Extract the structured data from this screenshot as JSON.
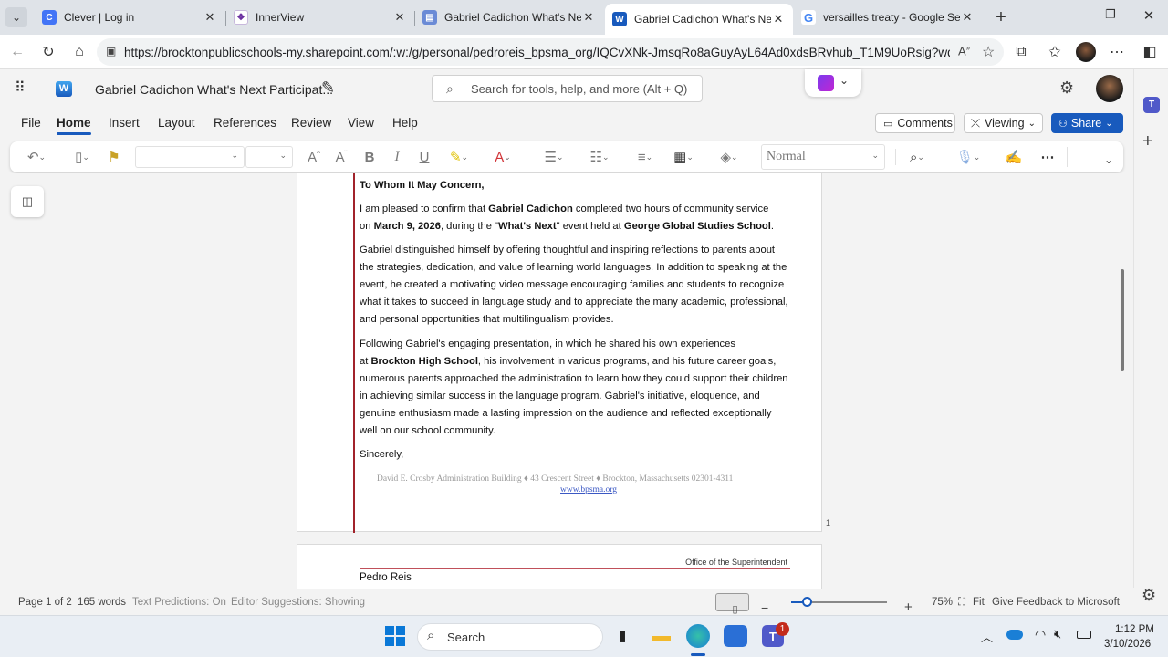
{
  "browser": {
    "tabs": [
      {
        "title": "Clever | Log in",
        "icon": "clever-icon",
        "color": "#4274f6"
      },
      {
        "title": "InnerView",
        "icon": "innerview-icon",
        "color": "#6b2fa0"
      },
      {
        "title": "Gabriel Cadichon What's Next F",
        "icon": "word-doc-icon",
        "color": "#6b8bd6"
      },
      {
        "title": "Gabriel Cadichon What's Next F",
        "icon": "word-icon",
        "color": "#185abd"
      },
      {
        "title": "versailles treaty - Google Searc",
        "icon": "google-icon",
        "color": "#4285f4"
      }
    ],
    "url": "https://brocktonpublicschools-my.sharepoint.com/:w:/g/personal/pedroreis_bpsma_org/IQCvXNk-JmsqRo8aGuyAyL64Ad0xdsBRvhub_T1M9UoRsig?wdOri..."
  },
  "word": {
    "doc_title": "Gabriel Cadichon What's Next Participat...",
    "search_placeholder": "Search for tools, help, and more (Alt + Q)",
    "menus": [
      "File",
      "Home",
      "Insert",
      "Layout",
      "References",
      "Review",
      "View",
      "Help"
    ],
    "comments_label": "Comments",
    "viewing_label": "Viewing",
    "share_label": "Share",
    "style_value": "Normal",
    "accent": "#185abd"
  },
  "document": {
    "salutation": "To Whom It May Concern,",
    "p1": [
      {
        "t": "I am pleased to confirm that "
      },
      {
        "t": "Gabriel Cadichon",
        "b": true
      },
      {
        "t": " completed two hours of community service"
      },
      {
        "br": true
      },
      {
        "t": "on "
      },
      {
        "t": "March 9, 2026",
        "b": true
      },
      {
        "t": ", during the \""
      },
      {
        "t": "What's Next",
        "b": true
      },
      {
        "t": "\" event held at "
      },
      {
        "t": "George Global Studies School",
        "b": true
      },
      {
        "t": "."
      }
    ],
    "p2_lines": [
      "Gabriel distinguished himself by offering thoughtful and inspiring reflections to parents about",
      "the strategies, dedication, and value of learning world languages. In addition to speaking at the",
      "event, he created a motivating video message encouraging families and students to recognize",
      "what it takes to succeed in language study and to appreciate the many academic, professional,",
      "and personal opportunities that multilingualism provides."
    ],
    "p3": [
      {
        "t": "Following Gabriel's engaging presentation, in which he shared his own experiences"
      },
      {
        "br": true
      },
      {
        "t": "at "
      },
      {
        "t": "Brockton High School",
        "b": true
      },
      {
        "t": ", his involvement in various programs, and his future career goals,"
      },
      {
        "br": true
      },
      {
        "t": "numerous parents approached the administration to learn how they could support their children"
      },
      {
        "br": true
      },
      {
        "t": "in achieving similar success in the language program. Gabriel's initiative, eloquence, and"
      },
      {
        "br": true
      },
      {
        "t": "genuine enthusiasm made a lasting impression on the audience and reflected exceptionally"
      },
      {
        "br": true
      },
      {
        "t": "well on our school community."
      }
    ],
    "closing": "Sincerely,",
    "footer_address": "David E. Crosby Administration Building ♦ 43 Crescent Street ♦ Brockton, Massachusetts 02301-4311",
    "footer_link": "www.bpsma.org",
    "page_number": "1",
    "page2_header": "Office of the Superintendent",
    "page2_name": "Pedro Reis"
  },
  "status": {
    "page": "Page 1 of 2",
    "words": "165 words",
    "text_predictions": "Text Predictions: On",
    "editor_suggestions": "Editor Suggestions: Showing",
    "zoom": "75%",
    "fit": "Fit",
    "feedback": "Give Feedback to Microsoft"
  },
  "taskbar": {
    "search_placeholder": "Search",
    "teams_badge": "1",
    "time": "1:12 PM",
    "date": "3/10/2026"
  }
}
